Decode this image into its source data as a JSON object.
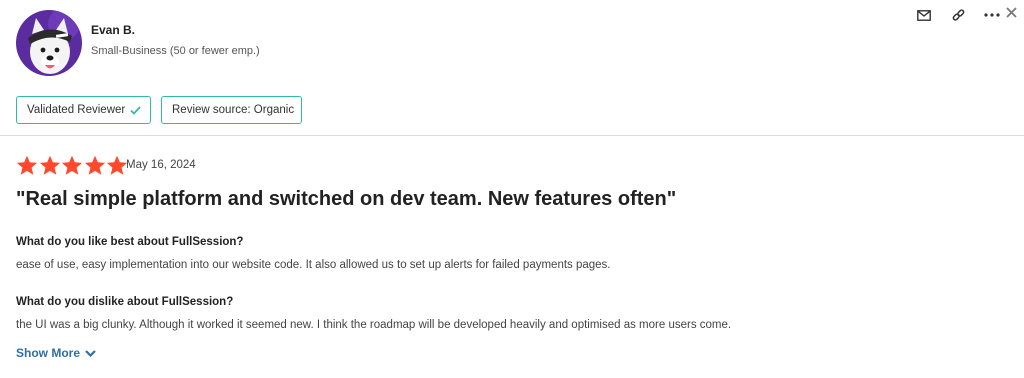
{
  "reviewer": {
    "name": "Evan B.",
    "segment": "Small-Business (50 or fewer emp.)",
    "avatar_icon": "dog-avatar"
  },
  "actions": {
    "icons": [
      "mail-icon",
      "link-icon",
      "more-icon",
      "close-icon"
    ]
  },
  "badges": {
    "validated": "Validated Reviewer",
    "source": "Review source: Organic"
  },
  "review": {
    "rating": 5,
    "max_rating": 5,
    "date": "May 16, 2024",
    "title": "\"Real simple platform and switched on dev team. New features often\"",
    "q1": "What do you like best about FullSession?",
    "a1": "ease of use, easy implementation into our website code. It also allowed us to set up alerts for failed payments pages.",
    "q2": "What do you dislike about FullSession?",
    "a2": "the UI was a big clunky. Although it worked it seemed new. I think the roadmap will be developed heavily and optimised as more users come.",
    "show_more": "Show More"
  },
  "colors": {
    "star": "#ff492c",
    "badge_border": "#2cbcac",
    "check": "#2cbcac",
    "link": "#2f6fa6",
    "avatar_bg": "#5a2ca0"
  }
}
